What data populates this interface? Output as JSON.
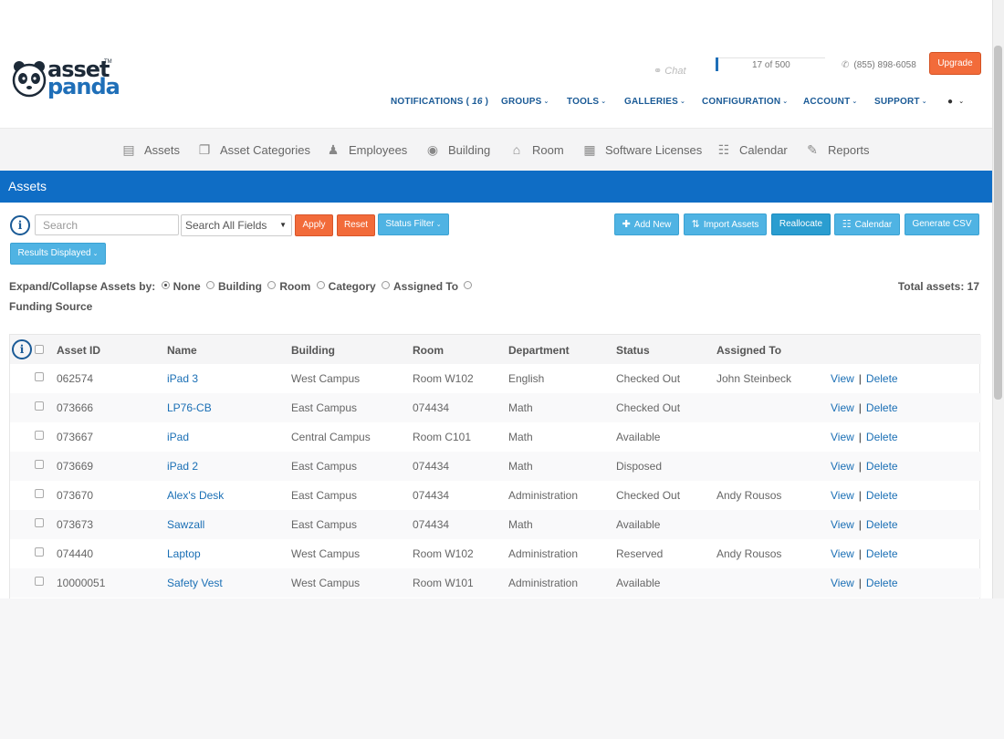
{
  "logo": {
    "line1": "asset",
    "line2": "panda",
    "tm": "TM"
  },
  "header": {
    "chat_label": "Chat",
    "plan_usage": "17 of 500",
    "plan_usage_fraction": 0.034,
    "phone": "(855) 898-6058",
    "upgrade_label": "Upgrade",
    "nav": {
      "notifications_label": "NOTIFICATIONS (",
      "notifications_count": "16",
      "notifications_close": ")",
      "groups": "GROUPS",
      "tools": "TOOLS",
      "galleries": "GALLERIES",
      "configuration": "CONFIGURATION",
      "account": "ACCOUNT",
      "support": "SUPPORT"
    }
  },
  "modules": [
    {
      "label": "Assets",
      "icon": "document-icon"
    },
    {
      "label": "Asset Categories",
      "icon": "categories-icon"
    },
    {
      "label": "Employees",
      "icon": "person-icon"
    },
    {
      "label": "Building",
      "icon": "map-pin-icon"
    },
    {
      "label": "Room",
      "icon": "home-icon"
    },
    {
      "label": "Software Licenses",
      "icon": "calculator-icon"
    },
    {
      "label": "Calendar",
      "icon": "calendar-icon"
    },
    {
      "label": "Reports",
      "icon": "edit-icon"
    }
  ],
  "page_title": "Assets",
  "toolbar": {
    "search_placeholder": "Search",
    "field_select": "Search All Fields",
    "apply_label": "Apply",
    "reset_label": "Reset",
    "status_filter_label": "Status Filter",
    "results_displayed_label": "Results Displayed",
    "add_new_label": "Add New",
    "import_assets_label": "Import Assets",
    "reallocate_label": "Reallocate",
    "calendar_label": "Calendar",
    "generate_csv_label": "Generate CSV"
  },
  "grouping": {
    "label": "Expand/Collapse Assets by:",
    "options": [
      "None",
      "Building",
      "Room",
      "Category",
      "Assigned To",
      "Funding Source"
    ],
    "selected": "None"
  },
  "total_assets": "Total assets: 17",
  "table": {
    "columns": [
      "Asset ID",
      "Name",
      "Building",
      "Room",
      "Department",
      "Status",
      "Assigned To"
    ],
    "view_label": "View",
    "delete_label": "Delete",
    "separator": "|",
    "rows": [
      {
        "asset_id": "062574",
        "name": "iPad 3",
        "building": "West Campus",
        "room": "Room W102",
        "department": "English",
        "status": "Checked Out",
        "assigned_to": "John Steinbeck"
      },
      {
        "asset_id": "073666",
        "name": "LP76-CB",
        "building": "East Campus",
        "room": "074434",
        "department": "Math",
        "status": "Checked Out",
        "assigned_to": ""
      },
      {
        "asset_id": "073667",
        "name": "iPad",
        "building": "Central Campus",
        "room": "Room C101",
        "department": "Math",
        "status": "Available",
        "assigned_to": ""
      },
      {
        "asset_id": "073669",
        "name": "iPad 2",
        "building": "East Campus",
        "room": "074434",
        "department": "Math",
        "status": "Disposed",
        "assigned_to": ""
      },
      {
        "asset_id": "073670",
        "name": "Alex's Desk",
        "building": "East Campus",
        "room": "074434",
        "department": "Administration",
        "status": "Checked Out",
        "assigned_to": "Andy Rousos"
      },
      {
        "asset_id": "073673",
        "name": "Sawzall",
        "building": "East Campus",
        "room": "074434",
        "department": "Math",
        "status": "Available",
        "assigned_to": ""
      },
      {
        "asset_id": "074440",
        "name": "Laptop",
        "building": "West Campus",
        "room": "Room W102",
        "department": "Administration",
        "status": "Reserved",
        "assigned_to": "Andy Rousos"
      },
      {
        "asset_id": "10000051",
        "name": "Safety Vest",
        "building": "West Campus",
        "room": "Room W101",
        "department": "Administration",
        "status": "Available",
        "assigned_to": ""
      }
    ]
  }
}
